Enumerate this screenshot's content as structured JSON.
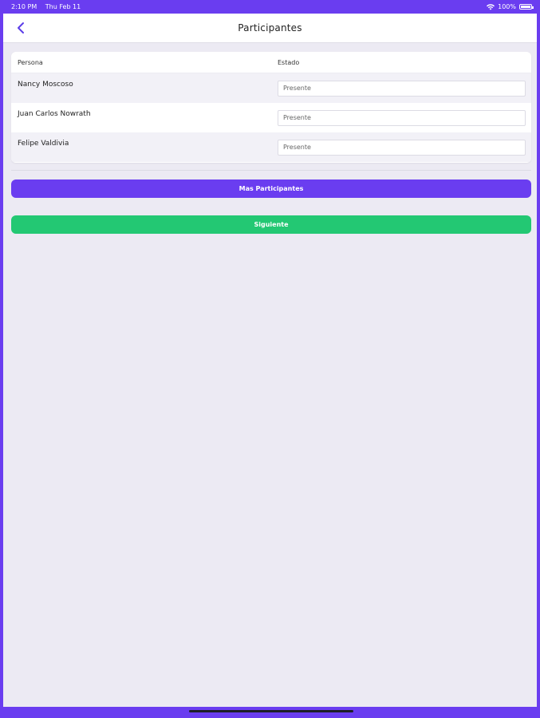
{
  "status_bar": {
    "time": "2:10 PM",
    "date": "Thu Feb 11",
    "battery": "100%",
    "icons": [
      "wifi-icon",
      "battery-icon"
    ]
  },
  "nav": {
    "title": "Participantes",
    "back_icon": "chevron-left-icon"
  },
  "table": {
    "headers": {
      "persona": "Persona",
      "estado": "Estado"
    },
    "rows": [
      {
        "name": "Nancy Moscoso",
        "estado": "Presente"
      },
      {
        "name": "Juan Carlos Nowrath",
        "estado": "Presente"
      },
      {
        "name": "Felipe Valdivia",
        "estado": "Presente"
      }
    ]
  },
  "buttons": {
    "more_label": "Mas Participantes",
    "next_label": "Siguiente"
  },
  "colors": {
    "accent": "#6a3df0",
    "success": "#23c873",
    "background": "#eceaf3"
  }
}
